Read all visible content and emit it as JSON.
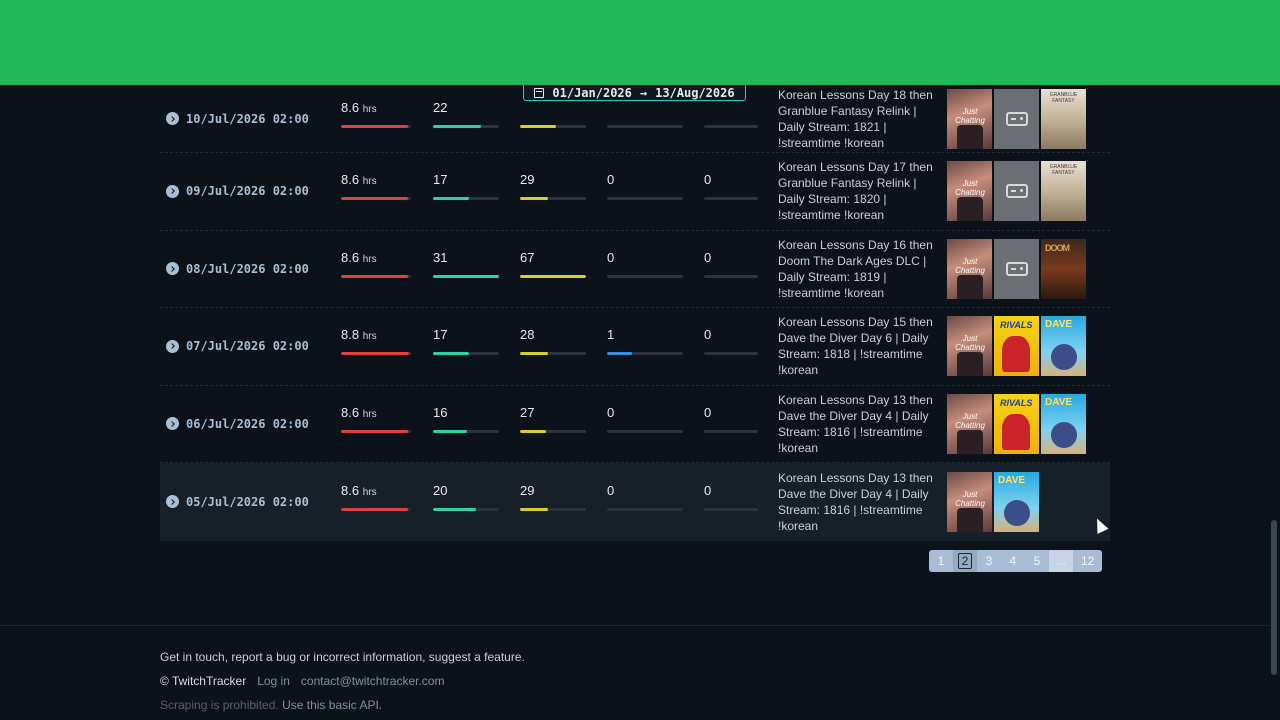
{
  "date_range": {
    "start": "01/Jan/2026",
    "arrow": "→",
    "end": "13/Aug/2026"
  },
  "colors": {
    "header": "#21b85c",
    "hours": "#e04040",
    "teal": "#2dd4a3",
    "yellow": "#d7cf2a",
    "blue": "#3a8fd9"
  },
  "rows": [
    {
      "date": "10/Jul/2026 02:00",
      "hours": "8.6",
      "hours_unit": "hrs",
      "hours_pct": 0.95,
      "c1": "22",
      "c1_pct": 0.72,
      "c2": "",
      "c2_pct": 0.55,
      "c3": "",
      "c3_pct": 0,
      "c4": "",
      "c4_pct": 0,
      "title": "Korean Lessons Day 18 then Granblue Fantasy Relink | Daily Stream: 1821 | !streamtime !korean",
      "thumbs": [
        "just-chatting-icon",
        "no-category-icon",
        "granblue-fantasy-relink-icon"
      ]
    },
    {
      "date": "09/Jul/2026 02:00",
      "hours": "8.6",
      "hours_unit": "hrs",
      "hours_pct": 0.95,
      "c1": "17",
      "c1_pct": 0.55,
      "c2": "29",
      "c2_pct": 0.43,
      "c3": "0",
      "c3_pct": 0,
      "c4": "0",
      "c4_pct": 0,
      "title": "Korean Lessons Day 17 then Granblue Fantasy Relink | Daily Stream: 1820 | !streamtime !korean",
      "thumbs": [
        "just-chatting-icon",
        "no-category-icon",
        "granblue-fantasy-relink-icon"
      ]
    },
    {
      "date": "08/Jul/2026 02:00",
      "hours": "8.6",
      "hours_unit": "hrs",
      "hours_pct": 0.95,
      "c1": "31",
      "c1_pct": 1.0,
      "c2": "67",
      "c2_pct": 1.0,
      "c3": "0",
      "c3_pct": 0,
      "c4": "0",
      "c4_pct": 0,
      "title": "Korean Lessons Day 16 then Doom The Dark Ages DLC | Daily Stream: 1819 | !streamtime !korean",
      "thumbs": [
        "just-chatting-icon",
        "no-category-icon",
        "doom-the-dark-ages-icon"
      ]
    },
    {
      "date": "07/Jul/2026 02:00",
      "hours": "8.8",
      "hours_unit": "hrs",
      "hours_pct": 0.97,
      "c1": "17",
      "c1_pct": 0.55,
      "c2": "28",
      "c2_pct": 0.42,
      "c3": "1",
      "c3_pct": 0.33,
      "c4": "0",
      "c4_pct": 0,
      "title": "Korean Lessons Day 15 then Dave the Diver Day 6 | Daily Stream: 1818 | !streamtime !korean",
      "thumbs": [
        "just-chatting-icon",
        "marvel-rivals-icon",
        "dave-the-diver-icon"
      ]
    },
    {
      "date": "06/Jul/2026 02:00",
      "hours": "8.6",
      "hours_unit": "hrs",
      "hours_pct": 0.95,
      "c1": "16",
      "c1_pct": 0.52,
      "c2": "27",
      "c2_pct": 0.4,
      "c3": "0",
      "c3_pct": 0,
      "c4": "0",
      "c4_pct": 0,
      "title": "Korean Lessons Day 13 then Dave the Diver Day 4 | Daily Stream: 1816 | !streamtime !korean",
      "thumbs": [
        "just-chatting-icon",
        "marvel-rivals-icon",
        "dave-the-diver-icon"
      ]
    },
    {
      "date": "05/Jul/2026 02:00",
      "hours": "8.6",
      "hours_unit": "hrs",
      "hours_pct": 0.95,
      "c1": "20",
      "c1_pct": 0.65,
      "c2": "29",
      "c2_pct": 0.43,
      "c3": "0",
      "c3_pct": 0,
      "c4": "0",
      "c4_pct": 0,
      "title": "Korean Lessons Day 13 then Dave the Diver Day 4 | Daily Stream: 1816 | !streamtime !korean",
      "thumbs": [
        "just-chatting-icon",
        "dave-the-diver-icon"
      ]
    }
  ],
  "thumb_labels": {
    "just": "Just Chatting",
    "gbf": "GRANBLUE FANTASY",
    "doom": "DOOM",
    "rivals": "RIVALS",
    "dave": "DAVE"
  },
  "pagination": {
    "pages": [
      "1",
      "2",
      "3",
      "4",
      "5",
      "...",
      "12"
    ],
    "current": "2"
  },
  "footer": {
    "contact_line": "Get in touch, report a bug or incorrect information, suggest a feature.",
    "copyright": "© TwitchTracker",
    "login": "Log in",
    "email": "contact@twitchtracker.com",
    "scraping": "Scraping is prohibited.",
    "api": "Use this basic API."
  }
}
